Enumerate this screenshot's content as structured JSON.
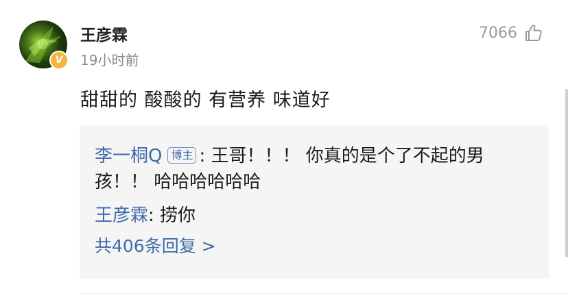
{
  "comment": {
    "username": "王彦霖",
    "verified_badge": "V",
    "time": "19小时前",
    "like_count": "7066",
    "like_icon": "thumbs-up-icon",
    "content": "甜甜的 酸酸的 有营养 味道好"
  },
  "replies": [
    {
      "user": "李一桐Q",
      "badge": "博主",
      "separator": ": ",
      "text": "王哥！！！ 你真的是个了不起的男孩！！ 哈哈哈哈哈哈"
    },
    {
      "user": "王彦霖",
      "separator": ": ",
      "text": "捞你"
    }
  ],
  "more_replies_label": "共406条回复 >",
  "colors": {
    "link": "#3f6aa8",
    "reply_bg": "#f5f5f5",
    "meta": "#8a8a8a",
    "verified": "#f2b63c"
  }
}
